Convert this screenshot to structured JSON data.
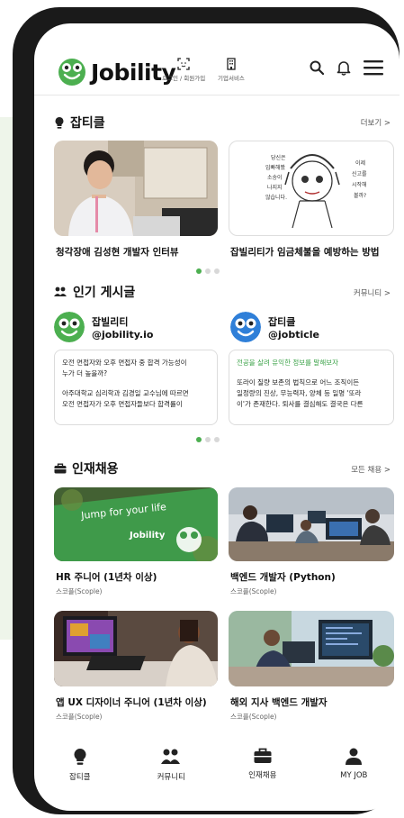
{
  "header": {
    "logo_text": "Jobility",
    "login_label": "로그인 / 회원가입",
    "business_label": "기업서비스"
  },
  "jobticle": {
    "title": "잡티클",
    "more": "더보기 >",
    "cards": [
      {
        "title": "청각장애 김성현 개발자 인터뷰"
      },
      {
        "title": "잡빌리티가 임금체불을 예방하는 방법"
      }
    ]
  },
  "popular": {
    "title": "인기 게시글",
    "more": "커뮤니티 >",
    "posts": [
      {
        "name": "잡빌리티",
        "handle": "@jobility.io",
        "line1": "오전 면접자와 오후 면접자 중 합격 가능성이",
        "line2": "누가 더 높을까?",
        "line3": "아주대학교 심리학과 김경일 교수님에 따르면",
        "line4": "오전 면접자가 오후 면접자들보다 합격률이"
      },
      {
        "name": "잡티클",
        "handle": "@jobticle",
        "line1": "전공을 살려 유익한 정보를 말해보자",
        "line2": "또라이 질량 보존의 법칙으로 어느 조직이든",
        "line3": "일정량의 진상, 무능력자, 양체 등 일명 '또라",
        "line4": "이'가 존재한다. 퇴사를 결심해도 결국은 다른"
      }
    ]
  },
  "jobs": {
    "title": "인재채용",
    "more": "모든 채용 >",
    "banner_text": "Jump for your life",
    "banner_brand": "Jobility",
    "items": [
      {
        "title": "HR 주니어 (1년차 이상)",
        "company": "스코플(Scople)"
      },
      {
        "title": "백엔드 개발자 (Python)",
        "company": "스코플(Scople)"
      },
      {
        "title": "앱 UX 디자이너 주니어 (1년차 이상)",
        "company": "스코플(Scople)"
      },
      {
        "title": "해외 지사 백엔드 개발자",
        "company": "스코플(Scople)"
      }
    ]
  },
  "cartoon_text": {
    "left": [
      "당신은",
      "임빠해봤",
      "소송이",
      "나지지",
      "않습니다."
    ],
    "right": [
      "이제",
      "신고를",
      "시작해",
      "볼까?"
    ]
  },
  "tabbar": {
    "items": [
      {
        "label": "잡티클",
        "icon": "bulb-icon"
      },
      {
        "label": "커뮤니티",
        "icon": "community-icon"
      },
      {
        "label": "인재채용",
        "icon": "briefcase-icon"
      },
      {
        "label": "MY JOB",
        "icon": "person-icon"
      }
    ]
  },
  "colors": {
    "accent": "#4caf50",
    "text": "#111111",
    "muted": "#666666"
  }
}
